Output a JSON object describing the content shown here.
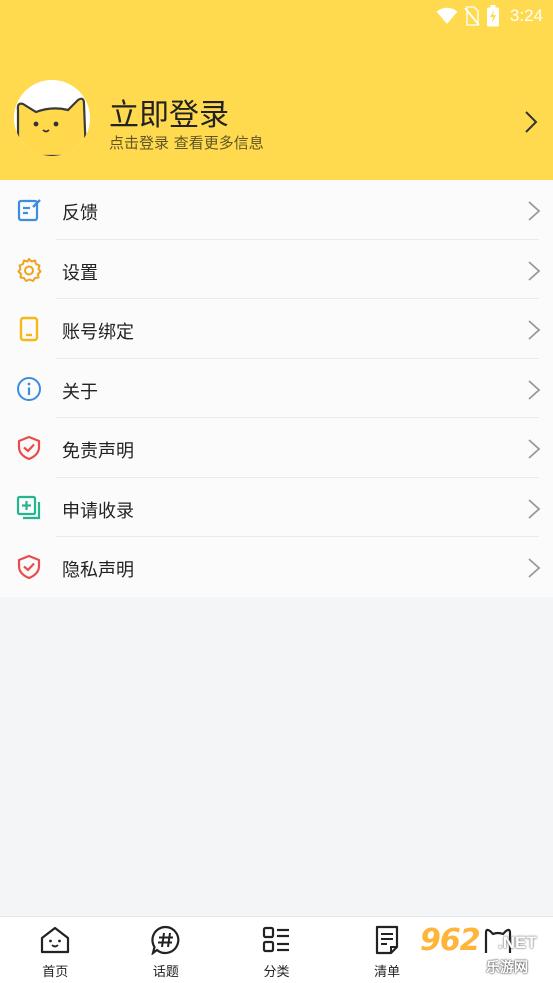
{
  "status_bar": {
    "time": "3:24",
    "icons": [
      "wifi-icon",
      "no-sim-icon",
      "battery-charging-icon"
    ]
  },
  "profile": {
    "title": "立即登录",
    "subtitle": "点击登录 查看更多信息",
    "avatar_icon": "cat-avatar-icon"
  },
  "menu": {
    "items": [
      {
        "label": "反馈",
        "icon": "feedback-icon",
        "color": "#3b8de0"
      },
      {
        "label": "设置",
        "icon": "gear-icon",
        "color": "#f0a31e"
      },
      {
        "label": "账号绑定",
        "icon": "phone-icon",
        "color": "#f3b915"
      },
      {
        "label": "关于",
        "icon": "info-icon",
        "color": "#3b8de0"
      },
      {
        "label": "免责声明",
        "icon": "shield-check-icon",
        "color": "#ec4b4b"
      },
      {
        "label": "申请收录",
        "icon": "add-square-icon",
        "color": "#23b58e"
      },
      {
        "label": "隐私声明",
        "icon": "shield-check-icon",
        "color": "#ec4b4b"
      }
    ]
  },
  "bottom_nav": {
    "items": [
      {
        "label": "首页",
        "icon": "home-icon"
      },
      {
        "label": "话题",
        "icon": "topic-hash-icon"
      },
      {
        "label": "分类",
        "icon": "category-icon"
      },
      {
        "label": "清单",
        "icon": "list-document-icon"
      },
      {
        "label": "",
        "icon": "cat-profile-icon"
      }
    ]
  },
  "watermark": {
    "number": "962",
    "suffix": ".NET",
    "text": "乐游网"
  },
  "colors": {
    "header_bg": "#ffda4f",
    "page_bg": "#f4f5f7"
  }
}
